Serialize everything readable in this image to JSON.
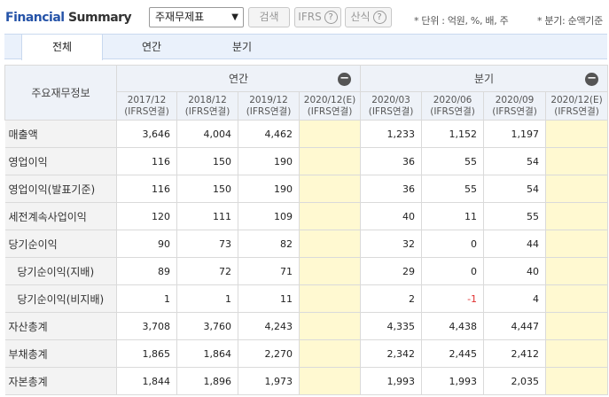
{
  "header": {
    "title_part1": "Financial",
    "title_part2": "Summary",
    "select_value": "주재무제표",
    "search_label": "검색",
    "ifrs_label": "IFRS",
    "calc_label": "산식",
    "help_glyph": "?",
    "unit_note": "* 단위 : 억원, %, 배, 주",
    "period_note": "* 분기: 순액기준"
  },
  "tabs": [
    {
      "label": "전체"
    },
    {
      "label": "연간"
    },
    {
      "label": "분기"
    }
  ],
  "table": {
    "row_header_label": "주요재무정보",
    "annual_group": "연간",
    "quarter_group": "분기",
    "collapse_glyph": "−",
    "periods": [
      {
        "period": "2017/12",
        "basis": "(IFRS연결)"
      },
      {
        "period": "2018/12",
        "basis": "(IFRS연결)"
      },
      {
        "period": "2019/12",
        "basis": "(IFRS연결)"
      },
      {
        "period": "2020/12(E)",
        "basis": "(IFRS연결)"
      },
      {
        "period": "2020/03",
        "basis": "(IFRS연결)"
      },
      {
        "period": "2020/06",
        "basis": "(IFRS연결)"
      },
      {
        "period": "2020/09",
        "basis": "(IFRS연결)"
      },
      {
        "period": "2020/12(E)",
        "basis": "(IFRS연결)"
      }
    ],
    "rows": [
      {
        "label": "매출액",
        "values": [
          "3,646",
          "4,004",
          "4,462",
          "",
          "1,233",
          "1,152",
          "1,197",
          ""
        ]
      },
      {
        "label": "영업이익",
        "values": [
          "116",
          "150",
          "190",
          "",
          "36",
          "55",
          "54",
          ""
        ]
      },
      {
        "label": "영업이익(발표기준)",
        "values": [
          "116",
          "150",
          "190",
          "",
          "36",
          "55",
          "54",
          ""
        ]
      },
      {
        "label": "세전계속사업이익",
        "values": [
          "120",
          "111",
          "109",
          "",
          "40",
          "11",
          "55",
          ""
        ]
      },
      {
        "label": "당기순이익",
        "values": [
          "90",
          "73",
          "82",
          "",
          "32",
          "0",
          "44",
          ""
        ]
      },
      {
        "label": "당기순이익(지배)",
        "values": [
          "89",
          "72",
          "71",
          "",
          "29",
          "0",
          "40",
          ""
        ]
      },
      {
        "label": "당기순이익(비지배)",
        "values": [
          "1",
          "1",
          "11",
          "",
          "2",
          "-1",
          "4",
          ""
        ]
      },
      {
        "label": "자산총계",
        "values": [
          "3,708",
          "3,760",
          "4,243",
          "",
          "4,335",
          "4,438",
          "4,447",
          ""
        ]
      },
      {
        "label": "부채총계",
        "values": [
          "1,865",
          "1,864",
          "2,270",
          "",
          "2,342",
          "2,445",
          "2,412",
          ""
        ]
      },
      {
        "label": "자본총계",
        "values": [
          "1,844",
          "1,896",
          "1,973",
          "",
          "1,993",
          "1,993",
          "2,035",
          ""
        ]
      }
    ]
  }
}
